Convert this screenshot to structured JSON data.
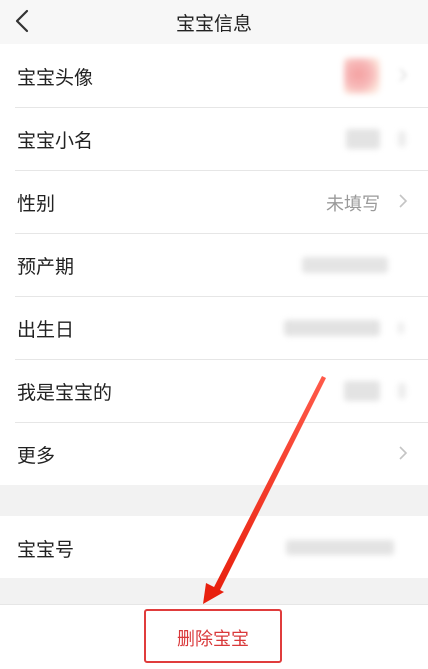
{
  "header": {
    "title": "宝宝信息"
  },
  "rows": [
    {
      "label": "宝宝头像",
      "value": ""
    },
    {
      "label": "宝宝小名",
      "value": ""
    },
    {
      "label": "性别",
      "value": "未填写"
    },
    {
      "label": "预产期",
      "value": ""
    },
    {
      "label": "出生日",
      "value": ""
    },
    {
      "label": "我是宝宝的",
      "value": ""
    },
    {
      "label": "更多",
      "value": ""
    }
  ],
  "baby_id_row": {
    "label": "宝宝号",
    "value": ""
  },
  "delete_button": {
    "label": "删除宝宝"
  },
  "colors": {
    "accent_red": "#e03c3c",
    "background": "#f2f2f2",
    "text": "#222222",
    "muted_text": "#9a9a9a"
  },
  "icons": {
    "back": "chevron-left-icon",
    "row_arrow": "chevron-right-icon"
  }
}
